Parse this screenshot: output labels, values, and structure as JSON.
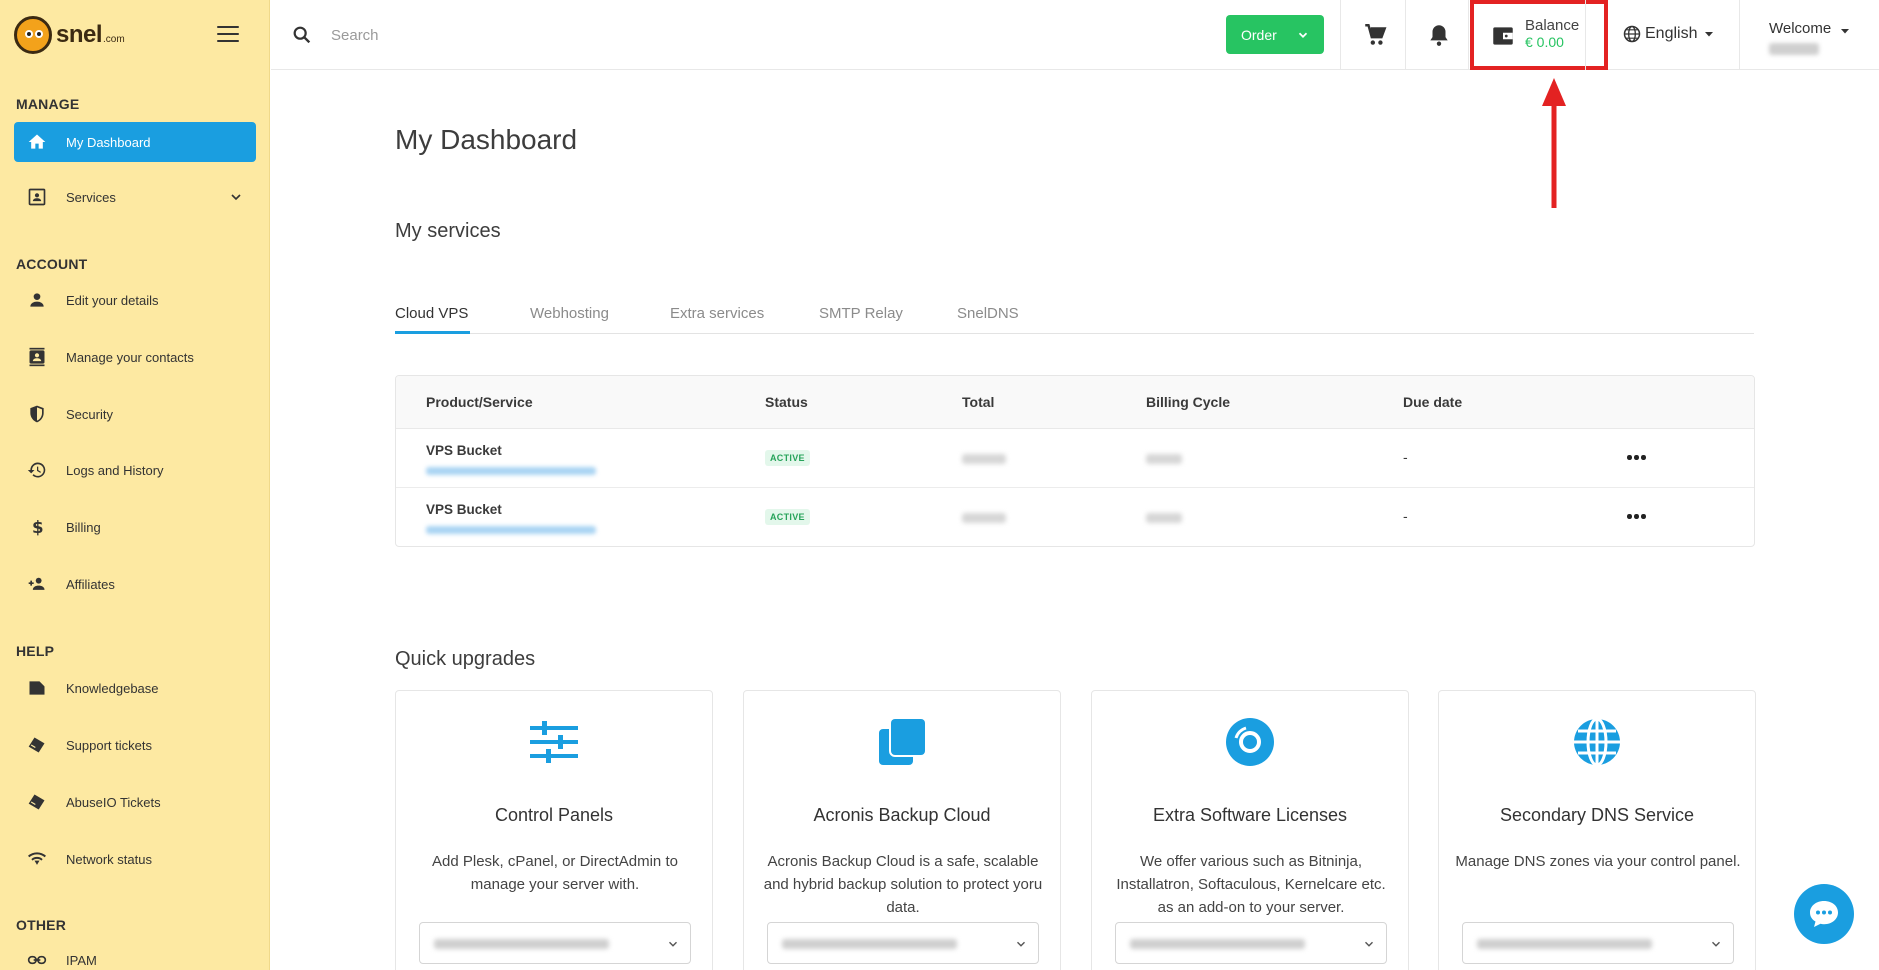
{
  "brand": {
    "name": "snel",
    "suffix": ".com"
  },
  "sidebar": {
    "sections": {
      "manage": "MANAGE",
      "account": "ACCOUNT",
      "help": "HELP",
      "other": "OTHER"
    },
    "items": [
      {
        "label": "My Dashboard",
        "icon": "home-icon",
        "active": true
      },
      {
        "label": "Services",
        "icon": "id-card-icon"
      },
      {
        "label": "Edit your details",
        "icon": "person-icon"
      },
      {
        "label": "Manage your contacts",
        "icon": "contacts-icon"
      },
      {
        "label": "Security",
        "icon": "shield-icon"
      },
      {
        "label": "Logs and History",
        "icon": "history-icon"
      },
      {
        "label": "Billing",
        "icon": "dollar-icon"
      },
      {
        "label": "Affiliates",
        "icon": "add-people-icon"
      },
      {
        "label": "Knowledgebase",
        "icon": "book-icon"
      },
      {
        "label": "Support tickets",
        "icon": "ticket-icon"
      },
      {
        "label": "AbuseIO Tickets",
        "icon": "ticket-icon"
      },
      {
        "label": "Network status",
        "icon": "wifi-icon"
      },
      {
        "label": "IPAM",
        "icon": "link-icon"
      }
    ]
  },
  "topbar": {
    "search_placeholder": "Search",
    "order_label": "Order",
    "balance_label": "Balance",
    "balance_amount": "€ 0.00",
    "language": "English",
    "welcome": "Welcome"
  },
  "main": {
    "title": "My Dashboard",
    "services_title": "My services",
    "tabs": [
      "Cloud VPS",
      "Webhosting",
      "Extra services",
      "SMTP Relay",
      "SnelDNS"
    ],
    "table": {
      "headers": [
        "Product/Service",
        "Status",
        "Total",
        "Billing Cycle",
        "Due date"
      ],
      "rows": [
        {
          "product": "VPS Bucket",
          "status": "ACTIVE",
          "due": "-"
        },
        {
          "product": "VPS Bucket",
          "status": "ACTIVE",
          "due": "-"
        }
      ]
    },
    "quick_title": "Quick upgrades",
    "cards": [
      {
        "title": "Control Panels",
        "desc": "Add Plesk, cPanel, or DirectAdmin to manage your server with.",
        "icon": "sliders-icon"
      },
      {
        "title": "Acronis Backup Cloud",
        "desc": "Acronis Backup Cloud is a safe, scalable and hybrid backup solution to protect yoru data.",
        "icon": "copy-icon"
      },
      {
        "title": "Extra Software Licenses",
        "desc": "We offer various such as Bitninja, Installatron, Softaculous, Kernelcare etc. as an add-on to your server.",
        "icon": "disc-icon"
      },
      {
        "title": "Secondary DNS Service",
        "desc": "Manage DNS zones via your control panel.",
        "icon": "globe-icon"
      }
    ]
  },
  "colors": {
    "sidebar_bg": "#fde9a2",
    "accent": "#1a9ee0",
    "order_green": "#27c462",
    "highlight_red": "#e32222"
  }
}
